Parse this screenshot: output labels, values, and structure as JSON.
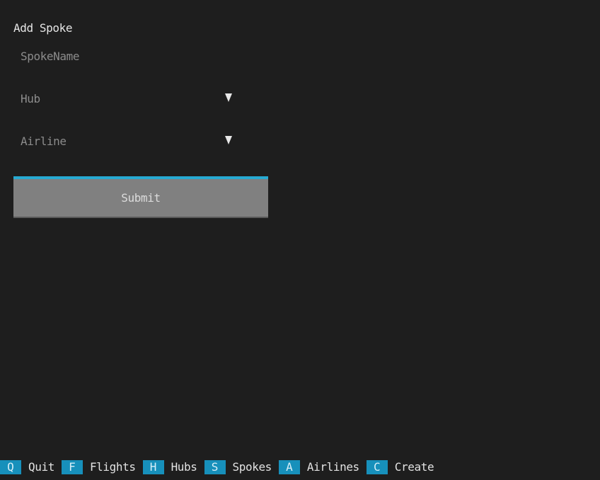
{
  "form": {
    "title": "Add Spoke",
    "spoke_name": {
      "value": "",
      "placeholder": "SpokeName"
    },
    "hub_select": {
      "selected": "",
      "placeholder": "Hub",
      "icon": "dropdown-arrow-icon"
    },
    "airline_select": {
      "selected": "",
      "placeholder": "Airline",
      "icon": "dropdown-arrow-icon"
    },
    "submit_label": "Submit"
  },
  "footer": {
    "bindings": [
      {
        "key": "Q",
        "label": "Quit"
      },
      {
        "key": "F",
        "label": "Flights"
      },
      {
        "key": "H",
        "label": "Hubs"
      },
      {
        "key": "S",
        "label": "Spokes"
      },
      {
        "key": "A",
        "label": "Airlines"
      },
      {
        "key": "C",
        "label": "Create"
      }
    ]
  },
  "colors": {
    "background": "#1e1e1e",
    "accent": "#27aad2",
    "key_background": "#1790bb",
    "button_background": "#808080",
    "placeholder_text": "#8c8c8c"
  }
}
